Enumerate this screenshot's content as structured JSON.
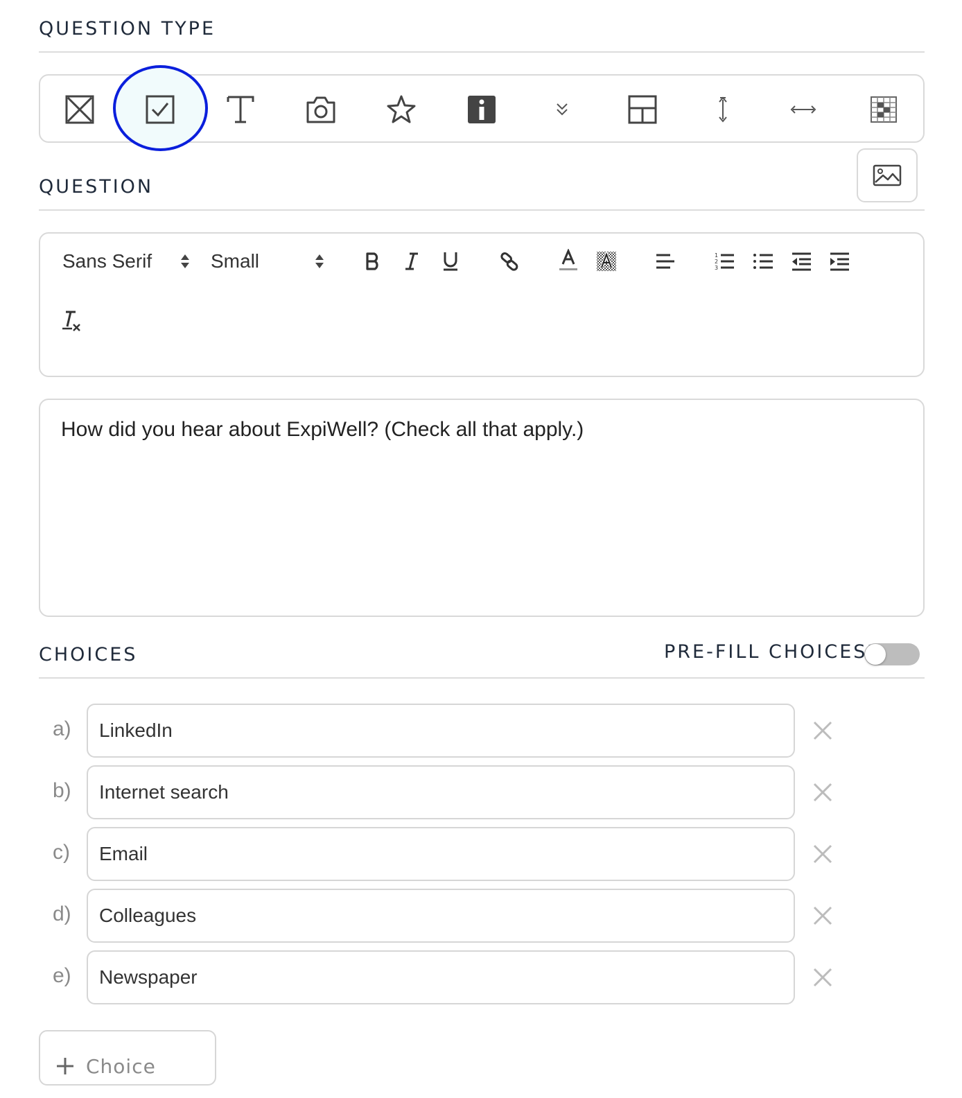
{
  "question_type": {
    "label": "QUESTION TYPE",
    "selected": "checkbox",
    "icons": [
      {
        "name": "crossed-box-icon"
      },
      {
        "name": "checkbox-icon"
      },
      {
        "name": "text-icon"
      },
      {
        "name": "camera-icon"
      },
      {
        "name": "star-icon"
      },
      {
        "name": "info-icon"
      },
      {
        "name": "double-chevron-down-icon"
      },
      {
        "name": "layout-icon"
      },
      {
        "name": "vertical-slider-icon"
      },
      {
        "name": "horizontal-slider-icon"
      },
      {
        "name": "grid-table-icon"
      }
    ],
    "highlight_color": "#0a1fdc"
  },
  "question": {
    "label": "QUESTION",
    "image_button_icon": "image-icon",
    "toolbar": {
      "font_family": "Sans Serif",
      "font_size": "Small"
    },
    "text": "How did you hear about ExpiWell? (Check all that apply.)"
  },
  "choices": {
    "label": "CHOICES",
    "prefill_label": "PRE-FILL CHOICES?",
    "prefill_enabled": false,
    "items": [
      {
        "letter": "a)",
        "value": "LinkedIn"
      },
      {
        "letter": "b)",
        "value": "Internet search"
      },
      {
        "letter": "c)",
        "value": "Email"
      },
      {
        "letter": "d)",
        "value": "Colleagues"
      },
      {
        "letter": "e)",
        "value": "Newspaper"
      }
    ],
    "add_button_label": "Choice"
  }
}
